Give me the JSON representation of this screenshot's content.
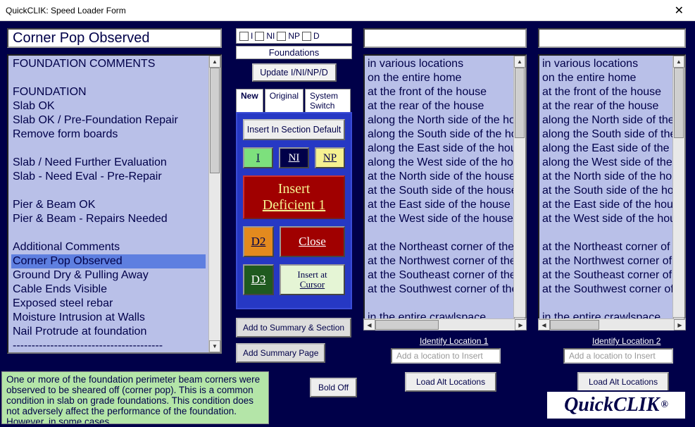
{
  "window": {
    "title": "QuickCLIK: Speed Loader Form"
  },
  "icons": {
    "close_x": "✕",
    "up": "▲",
    "down": "▼",
    "left": "◀",
    "right": "▶"
  },
  "selected_title": "Corner Pop Observed",
  "left_list": [
    "FOUNDATION COMMENTS",
    "",
    "FOUNDATION",
    "Slab OK",
    "Slab OK / Pre-Foundation Repair",
    "Remove form boards",
    "",
    "Slab / Need Further Evaluation",
    "Slab - Need Eval - Pre-Repair",
    "",
    "Pier & Beam OK",
    "Pier & Beam - Repairs Needed",
    "",
    "Additional Comments",
    "Corner Pop Observed",
    "Ground Dry & Pulling Away",
    "Cable Ends Visible",
    "Exposed steel rebar",
    "Moisture Intrusion at Walls",
    "Nail Protrude at foundation",
    "----------------------------------------"
  ],
  "left_selected_index": 14,
  "description": "One or more of the foundation perimeter beam corners were observed to be sheared off (corner pop). This is a common condition in slab on grade foundations. This condition does not adversely affect the performance of the foundation. However, in some cases.",
  "flags": {
    "I": "I",
    "NI": "NI",
    "NP": "NP",
    "D": "D"
  },
  "category_label": "Foundations",
  "update_btn": "Update I/NI/NP/D",
  "tabs": {
    "new": "New",
    "original": "Original",
    "system": "System Switch"
  },
  "panel": {
    "insert_default": "Insert In Section Default",
    "I": "I",
    "NI": "NI",
    "NP": "NP",
    "insert_def_l1": "Insert",
    "insert_def_l2": "Deficient 1",
    "D2": "D2",
    "D3": "D3",
    "close": "Close",
    "cursor_l1": "Insert at",
    "cursor_l2": "Cursor"
  },
  "buttons": {
    "add_summary_section": "Add to Summary & Section",
    "add_summary_page": "Add Summary Page",
    "bold_off": "Bold Off",
    "identify1": "Identify Location 1",
    "identify2": "Identify Location 2",
    "placeholder1": "Add a location to Insert",
    "placeholder2": "Add a location to Insert",
    "load_alt": "Load Alt Locations"
  },
  "locations": [
    "in various locations",
    "on the entire home",
    "at the front of the house",
    "at the rear of the house",
    "along the North side of the house",
    "along the South side of the house",
    "along the East side of the house",
    "along the West side of the house",
    "at the North side of the house",
    "at the South side of the house",
    "at the East side of the house",
    "at the West side of the house",
    "",
    "at the Northeast corner of the",
    "at the Northwest corner of the",
    "at the Southeast corner of the",
    "at the Southwest corner of the",
    "",
    "in the entire crawlspace"
  ],
  "logo": {
    "text": "QuickCLIK",
    "reg": "®"
  }
}
